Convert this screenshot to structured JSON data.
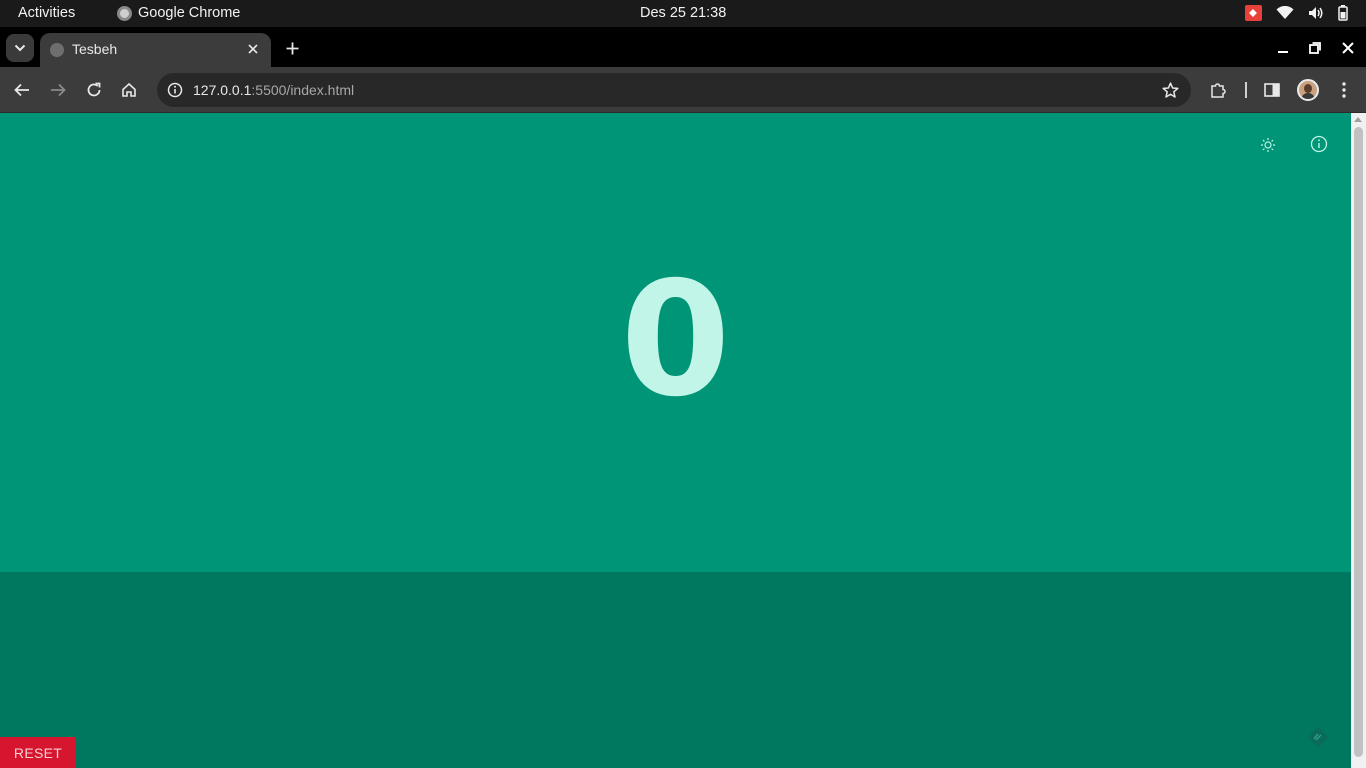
{
  "os_bar": {
    "activities": "Activities",
    "app_name": "Google Chrome",
    "clock": "Des 25  21:38"
  },
  "browser": {
    "tab_title": "Tesbeh",
    "url_host": "127.0.0.1",
    "url_rest": ":5500/index.html"
  },
  "app": {
    "counter_value": "0",
    "reset_label": "RESET",
    "colors": {
      "top_background": "#009577",
      "bottom_background": "#00775f",
      "counter_text": "#c0f5e8",
      "reset_background": "#d6152f"
    },
    "icons": {
      "theme": "sun-icon",
      "about": "info-icon",
      "corner": "diamond-icon"
    }
  }
}
